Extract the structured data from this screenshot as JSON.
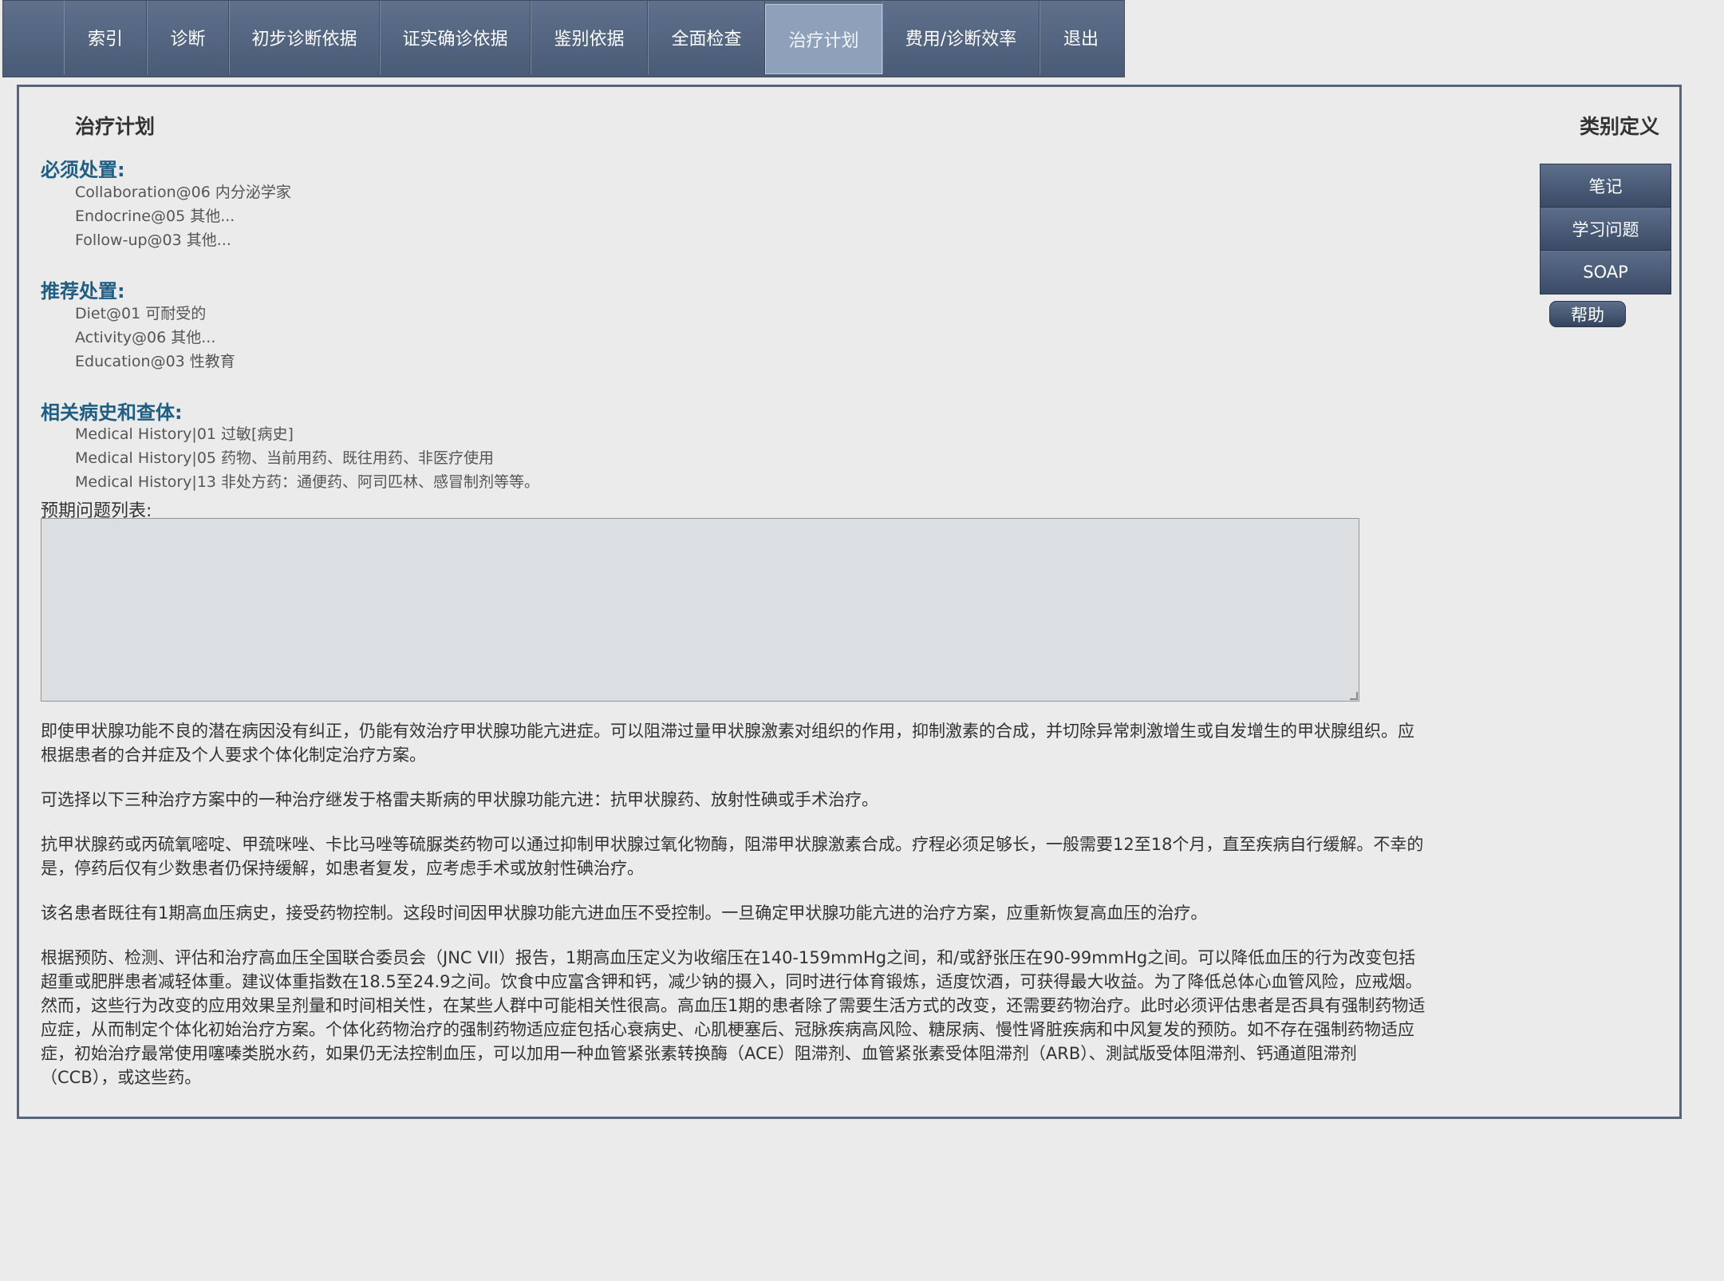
{
  "nav": {
    "tabs": [
      {
        "label": "索引"
      },
      {
        "label": "诊断"
      },
      {
        "label": "初步诊断依据"
      },
      {
        "label": "证实确诊依据"
      },
      {
        "label": "鉴别依据"
      },
      {
        "label": "全面检查"
      },
      {
        "label": "治疗计划",
        "active": true
      },
      {
        "label": "费用/诊断效率"
      },
      {
        "label": "退出"
      }
    ]
  },
  "panel": {
    "title": "治疗计划",
    "category_definition": "类别定义"
  },
  "required": {
    "heading": "必须处置:",
    "items": [
      "Collaboration@06 内分泌学家",
      "Endocrine@05 其他...",
      "Follow-up@03 其他..."
    ]
  },
  "recommended": {
    "heading": "推荐处置:",
    "items": [
      "Diet@01 可耐受的",
      "Activity@06 其他...",
      "Education@03 性教育"
    ]
  },
  "history": {
    "heading": "相关病史和查体:",
    "items": [
      "Medical History|01 过敏[病史]",
      "Medical History|05 药物、当前用药、既往用药、非医疗使用",
      "Medical History|13 非处方药：通便药、阿司匹林、感冒制剂等等。"
    ]
  },
  "expected_problems": {
    "label": "预期问题列表:",
    "value": ""
  },
  "body": {
    "paragraphs": [
      "即使甲状腺功能不良的潜在病因没有纠正，仍能有效治疗甲状腺功能亢进症。可以阻滞过量甲状腺激素对组织的作用，抑制激素的合成，并切除异常刺激增生或自发增生的甲状腺组织。应根据患者的合并症及个人要求个体化制定治疗方案。",
      "可选择以下三种治疗方案中的一种治疗继发于格雷夫斯病的甲状腺功能亢进：抗甲状腺药、放射性碘或手术治疗。",
      "抗甲状腺药或丙硫氧嘧啶、甲巯咪唑、卡比马唑等硫脲类药物可以通过抑制甲状腺过氧化物酶，阻滞甲状腺激素合成。疗程必须足够长，一般需要12至18个月，直至疾病自行缓解。不幸的是，停药后仅有少数患者仍保持缓解，如患者复发，应考虑手术或放射性碘治疗。",
      "该名患者既往有1期高血压病史，接受药物控制。这段时间因甲状腺功能亢进血压不受控制。一旦确定甲状腺功能亢进的治疗方案，应重新恢复高血压的治疗。",
      "根据预防、检测、评估和治疗高血压全国联合委员会（JNC VII）报告，1期高血压定义为收缩压在140-159mmHg之间，和/或舒张压在90-99mmHg之间。可以降低血压的行为改变包括超重或肥胖患者减轻体重。建议体重指数在18.5至24.9之间。饮食中应富含钾和钙，减少钠的摄入，同时进行体育锻炼，适度饮酒，可获得最大收益。为了降低总体心血管风险，应戒烟。然而，这些行为改变的应用效果呈剂量和时间相关性，在某些人群中可能相关性很高。高血压1期的患者除了需要生活方式的改变，还需要药物治疗。此时必须评估患者是否具有强制药物适应症，从而制定个体化初始治疗方案。个体化药物治疗的强制药物适应症包括心衰病史、心肌梗塞后、冠脉疾病高风险、糖尿病、慢性肾脏疾病和中风复发的预防。如不存在强制药物适应症，初始治疗最常使用噻嗪类脱水药，如果仍无法控制血压，可以加用一种血管紧张素转换酶（ACE）阻滞剂、血管紧张素受体阻滞剂（ARB）、測試版受体阻滞剂、钙通道阻滞剂（CCB），或这些药。"
    ]
  },
  "side": {
    "buttons": [
      "笔记",
      "学习问题",
      "SOAP"
    ],
    "help": "帮助"
  }
}
